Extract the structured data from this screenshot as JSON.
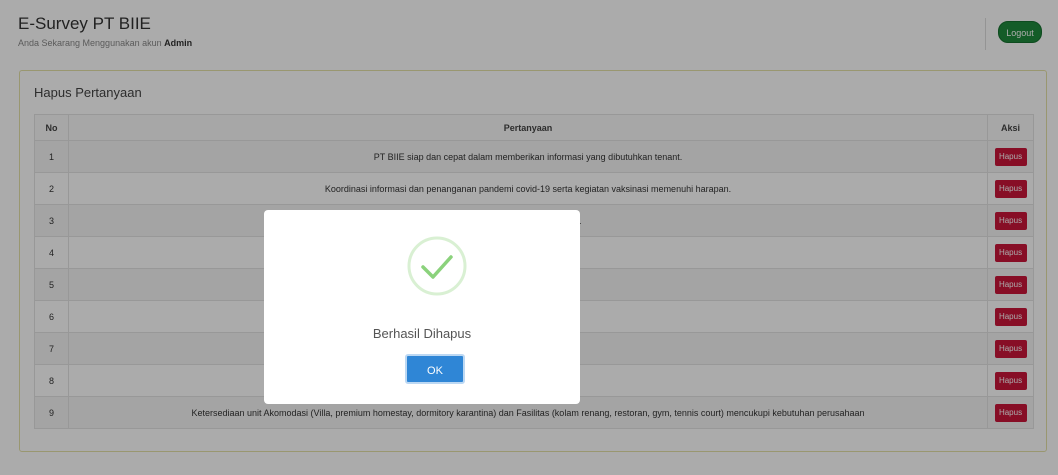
{
  "header": {
    "title": "E-Survey PT BIIE",
    "subtitle_prefix": "Anda Sekarang Menggunakan akun",
    "account": "Admin",
    "logout_label": "Logout"
  },
  "panel": {
    "title": "Hapus Pertanyaan",
    "columns": {
      "no": "No",
      "question": "Pertanyaan",
      "action": "Aksi"
    },
    "rows": [
      {
        "no": "1",
        "question": "PT BIIE siap dan cepat dalam memberikan informasi yang dibutuhkan tenant.",
        "action": "Hapus"
      },
      {
        "no": "2",
        "question": "Koordinasi informasi dan penanganan pandemi covid-19 serta kegiatan vaksinasi memenuhi harapan.",
        "action": "Hapus"
      },
      {
        "no": "3",
        "question": "ra sesuai dengan harapan.",
        "action": "Hapus"
      },
      {
        "no": "4",
        "question": "essional.",
        "action": "Hapus"
      },
      {
        "no": "5",
        "question": "",
        "action": "Hapus"
      },
      {
        "no": "6",
        "question": "tuhkan perusahaan.",
        "action": "Hapus"
      },
      {
        "no": "7",
        "question": "nuhi harapan",
        "action": "Hapus"
      },
      {
        "no": "8",
        "question": "n",
        "action": "Hapus"
      },
      {
        "no": "9",
        "question": "Ketersediaan unit Akomodasi (Villa, premium homestay, dormitory karantina) dan Fasilitas (kolam renang, restoran, gym, tennis court) mencukupi kebutuhan perusahaan",
        "action": "Hapus"
      }
    ]
  },
  "modal": {
    "message": "Berhasil Dihapus",
    "ok_label": "OK",
    "icon": "success-check-icon"
  },
  "colors": {
    "logout": "#1e8a3c",
    "hapus": "#c9163a",
    "ok": "#2f86d6",
    "check": "#8bd27c"
  }
}
